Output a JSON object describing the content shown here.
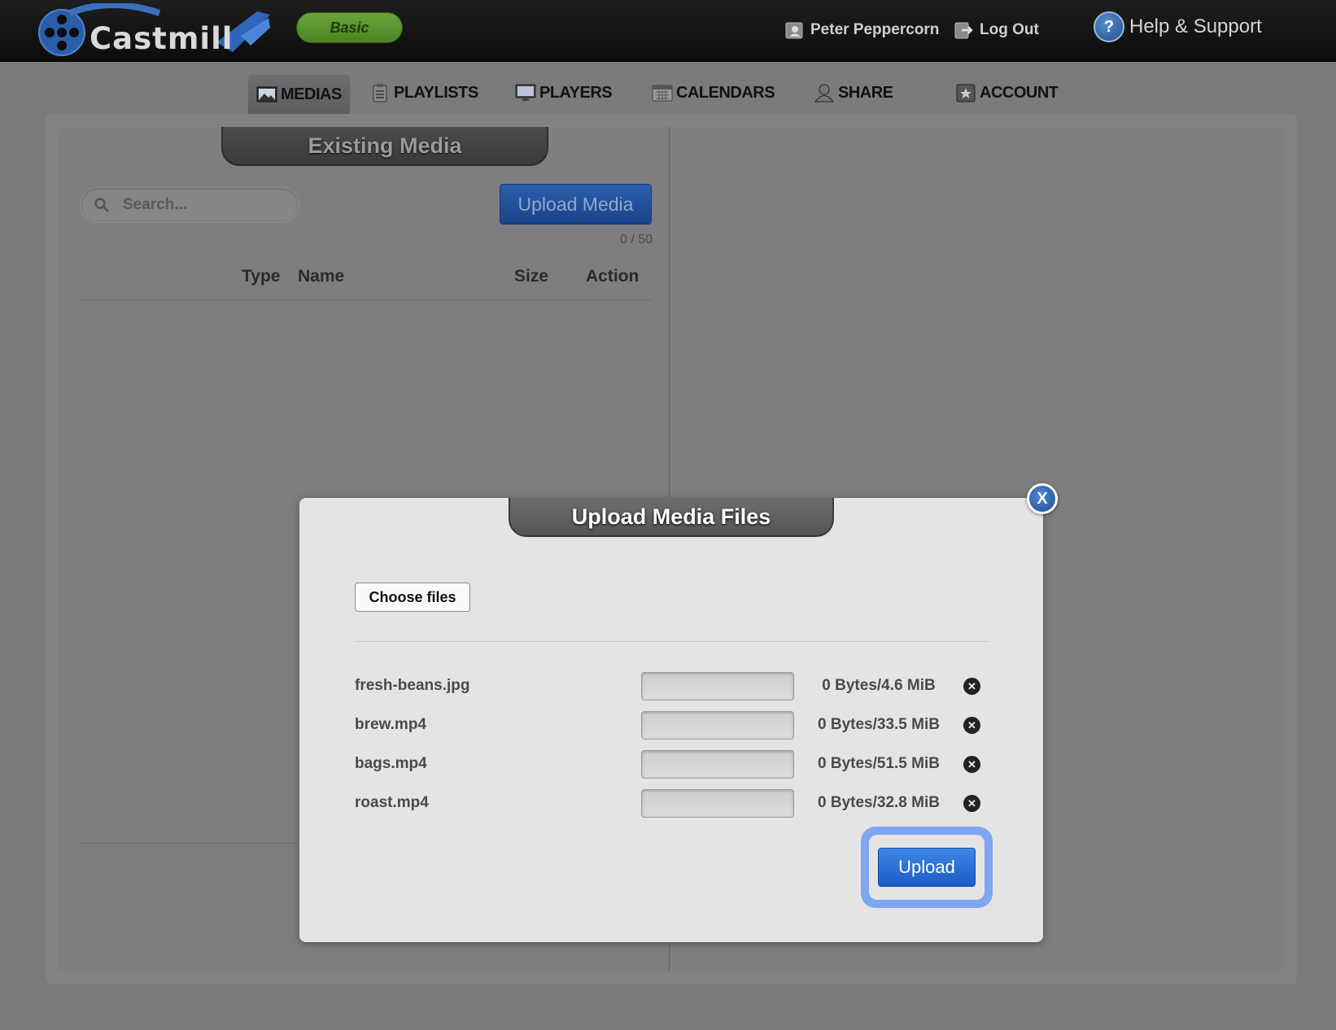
{
  "header": {
    "logo_text": "Castmill",
    "plan_badge": "Basic",
    "user_name": "Peter Peppercorn",
    "logout_label": "Log Out",
    "help_label": "Help & Support",
    "help_glyph": "?"
  },
  "nav": {
    "items": [
      {
        "label": "MEDIAS",
        "icon": "image-icon",
        "active": true
      },
      {
        "label": "PLAYLISTS",
        "icon": "clipboard-icon",
        "active": false
      },
      {
        "label": "PLAYERS",
        "icon": "monitor-icon",
        "active": false
      },
      {
        "label": "CALENDARS",
        "icon": "calendar-icon",
        "active": false
      },
      {
        "label": "SHARE",
        "icon": "user-icon",
        "active": false
      },
      {
        "label": "ACCOUNT",
        "icon": "star-badge-icon",
        "active": false
      }
    ]
  },
  "media_panel": {
    "title": "Existing Media",
    "search_placeholder": "Search...",
    "upload_label": "Upload Media",
    "quota": "0 / 50",
    "columns": [
      "Type",
      "Name",
      "Size",
      "Action"
    ]
  },
  "modal": {
    "title": "Upload Media Files",
    "close_label": "X",
    "choose_label": "Choose files",
    "files": [
      {
        "name": "fresh-beans.jpg",
        "size": "0 Bytes/4.6 MiB",
        "progress": 0
      },
      {
        "name": "brew.mp4",
        "size": "0 Bytes/33.5 MiB",
        "progress": 0
      },
      {
        "name": "bags.mp4",
        "size": "0 Bytes/51.5 MiB",
        "progress": 0
      },
      {
        "name": "roast.mp4",
        "size": "0 Bytes/32.8 MiB",
        "progress": 0
      }
    ],
    "remove_glyph": "✕",
    "upload_label": "Upload"
  },
  "colors": {
    "accent_blue": "#1d5cc4",
    "plan_green": "#5a9530",
    "focus_ring": "#7fa6f0"
  }
}
